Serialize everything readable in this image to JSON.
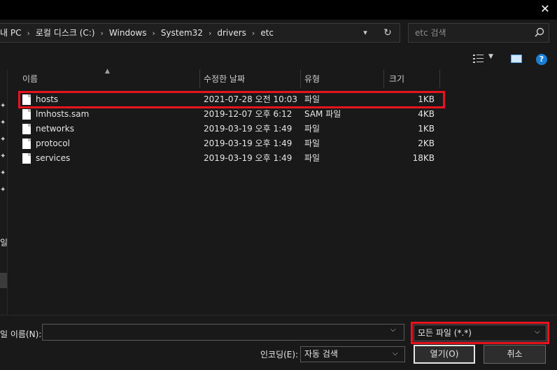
{
  "address": {
    "crumbs": [
      "내 PC",
      "로컬 디스크 (C:)",
      "Windows",
      "System32",
      "drivers",
      "etc"
    ]
  },
  "search": {
    "placeholder": "etc 검색"
  },
  "columns": {
    "name": "이름",
    "modified": "수정한 날짜",
    "type": "유형",
    "size": "크기"
  },
  "files": [
    {
      "name": "hosts",
      "modified": "2021-07-28 오전 10:03",
      "type": "파일",
      "size": "1KB"
    },
    {
      "name": "lmhosts.sam",
      "modified": "2019-12-07 오후 6:12",
      "type": "SAM 파일",
      "size": "4KB"
    },
    {
      "name": "networks",
      "modified": "2019-03-19 오후 1:49",
      "type": "파일",
      "size": "1KB"
    },
    {
      "name": "protocol",
      "modified": "2019-03-19 오후 1:49",
      "type": "파일",
      "size": "2KB"
    },
    {
      "name": "services",
      "modified": "2019-03-19 오후 1:49",
      "type": "파일",
      "size": "18KB"
    }
  ],
  "nav": {
    "partial_label": "일"
  },
  "bottom": {
    "filename_label": "일 이름(N):",
    "filename_value": "",
    "filter_value": "모든 파일 (*.*)",
    "encoding_label": "인코딩(E):",
    "encoding_value": "자동 검색",
    "open_label": "열기(O)",
    "cancel_label": "취소"
  },
  "colors": {
    "highlight": "#e8131e",
    "background": "#191919",
    "help_accent": "#1a7fd4"
  },
  "icons": [
    "close-icon",
    "refresh-icon",
    "search-icon",
    "view-options-icon",
    "preview-pane-icon",
    "help-icon",
    "file-icon",
    "pin-icon"
  ]
}
